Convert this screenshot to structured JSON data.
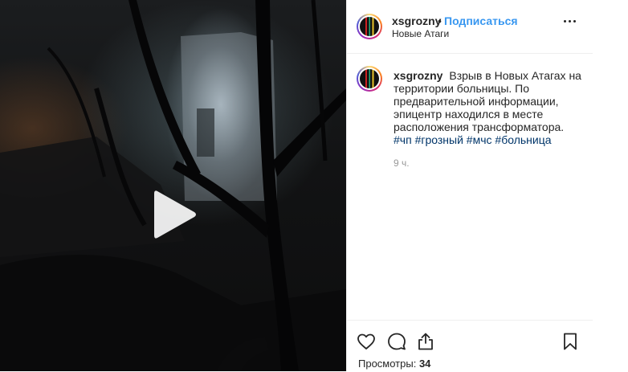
{
  "post": {
    "author": {
      "username": "xsgrozny",
      "follow_label": "Подписаться",
      "separator": "•"
    },
    "location": "Новые Атаги",
    "caption": {
      "text": "Взрыв в Новых Атагах на территории больницы. По предварительной информации, эпицентр находился в месте расположения трансформатора.",
      "hashtags": [
        "#чп",
        "#грозный",
        "#мчс",
        "#больница"
      ]
    },
    "timestamp": "9 ч.",
    "views": {
      "label": "Просмотры:",
      "count": "34"
    }
  },
  "icons": {
    "play": "play-icon",
    "more": "more-options-icon",
    "like": "heart-icon",
    "comment": "comment-icon",
    "share": "share-icon",
    "save": "bookmark-icon"
  },
  "colors": {
    "link_blue": "#3897f0",
    "hashtag": "#003569",
    "text": "#262626",
    "muted": "#999999",
    "border": "#efefef"
  }
}
